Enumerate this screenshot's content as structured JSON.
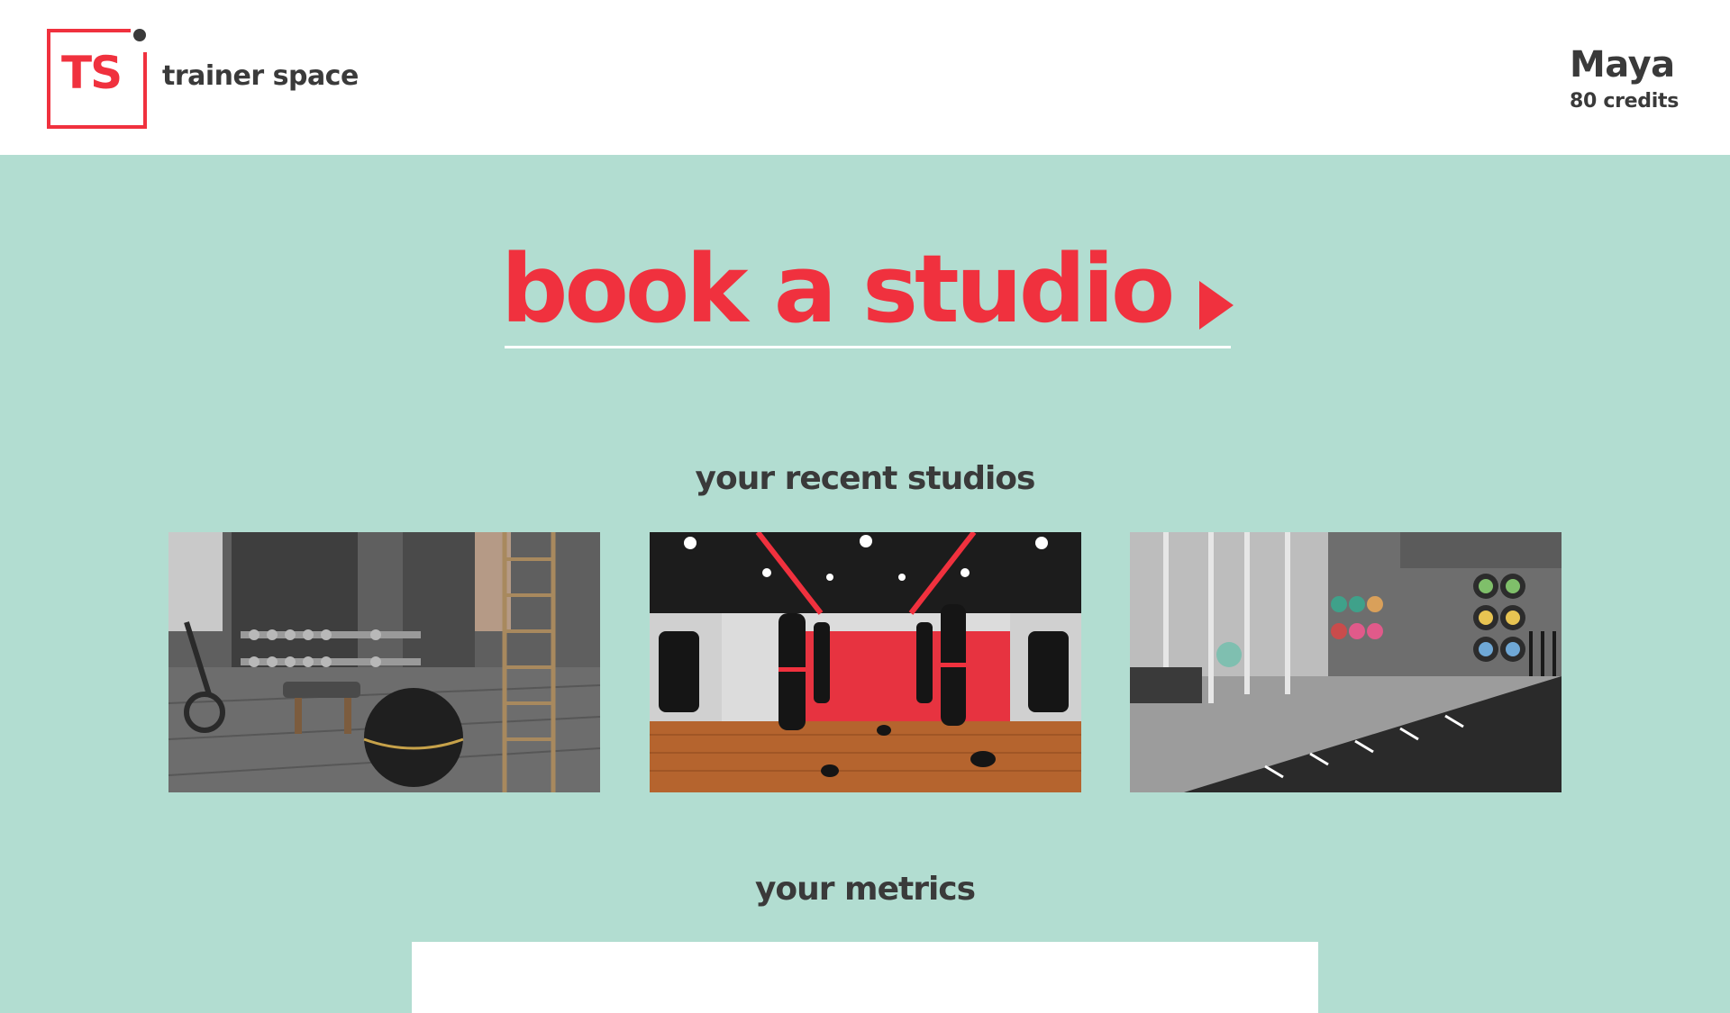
{
  "brand": {
    "logo_letters": "TS",
    "name": "trainer space",
    "accent_color": "#f0313e"
  },
  "user": {
    "name": "Maya",
    "credits": "80 credits"
  },
  "cta": {
    "label": "book a studio",
    "icon": "play-arrow-icon"
  },
  "recent_studios": {
    "title": "your recent studios",
    "items": [
      {
        "image": "studio-photo-gym-bench-ball"
      },
      {
        "image": "studio-photo-boxing-bags"
      },
      {
        "image": "studio-photo-functional-training"
      }
    ]
  },
  "metrics": {
    "title": "your metrics"
  },
  "colors": {
    "background": "#b2ddd1",
    "header": "#ffffff",
    "text": "#3a3a3a"
  }
}
